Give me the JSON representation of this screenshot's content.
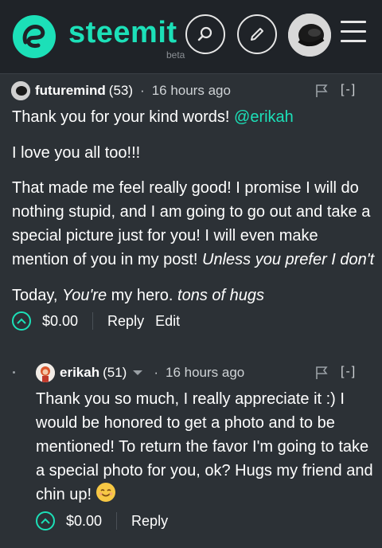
{
  "header": {
    "logo_text": "steemit",
    "logo_badge": "beta",
    "brand_color": "#1ce0b8"
  },
  "comments": [
    {
      "author": "futuremind",
      "reputation": "(53)",
      "separator": "·",
      "time": "16 hours ago",
      "collapse": "[-]",
      "paragraphs": [
        {
          "text": "Thank you for your kind words! ",
          "mention": "@erikah"
        },
        {
          "text": "I love you all too!!!"
        },
        {
          "text_lines": [
            "That made me feel really good! I promise I will do",
            "nothing stupid, and I am going to go out and take a",
            "special picture just for you! I will even make"
          ],
          "last_line": "mention of you in my post! ",
          "last_italic": "Unless you prefer I don't"
        },
        {
          "prefix": "Today, ",
          "italic1": "You're",
          "middle": " my hero. ",
          "italic2": "tons of hugs"
        }
      ],
      "payout": "$0.00",
      "reply_label": "Reply",
      "edit_label": "Edit"
    },
    {
      "author": "erikah",
      "reputation": "(51)",
      "separator": "·",
      "time": "16 hours ago",
      "collapse": "[-]",
      "body_lines": [
        "Thank you so much, I really appreciate it :) I",
        "would be honored to get a photo and to be",
        "mentioned! To return the favor I'm going to take",
        "a special photo for you, ok? Hugs my friend and"
      ],
      "body_last": "chin up! ",
      "payout": "$0.00",
      "reply_label": "Reply"
    }
  ]
}
